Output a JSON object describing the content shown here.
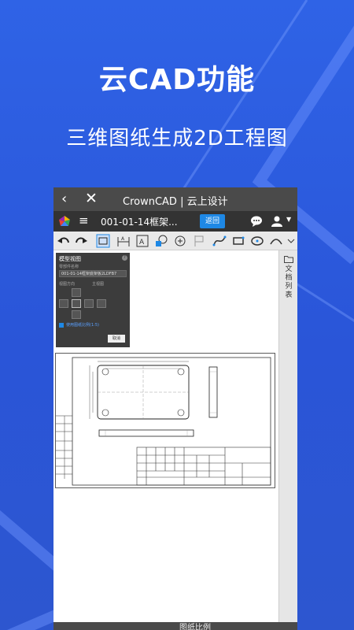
{
  "colors": {
    "background": "#2f63e6",
    "accent": "#1e88e5",
    "titlebar": "#4a4a4a",
    "appbar": "#333333",
    "toolbar": "#e9e9e9"
  },
  "headline": "云CAD功能",
  "subline": "三维图纸生成2D工程图",
  "titlebar": {
    "back_icon": "chevron-left-icon",
    "close_icon": "close-icon",
    "title": "CrownCAD | 云上设计"
  },
  "appbar": {
    "document_name": "001-01-14框架...",
    "return_label": "返回",
    "icons": [
      "logo-icon",
      "menu-icon",
      "chat-icon",
      "user-icon",
      "chevron-down-icon"
    ]
  },
  "toolbar": {
    "icons": [
      "undo-icon",
      "redo-icon",
      "view-icon",
      "dimension-icon",
      "annotation-icon",
      "balloon-icon",
      "center-mark-icon",
      "flag-icon",
      "spline-icon",
      "rectangle-icon",
      "circle-icon",
      "arc-icon",
      "more-icon"
    ]
  },
  "right_panel": {
    "folder_icon": "folder-icon",
    "label": "文档列表"
  },
  "view_panel": {
    "title": "模型视图",
    "field_label": "零部件名称",
    "field_value": "001-01-14框架底架板2LDFB7",
    "orientation_label": "视图方向",
    "preset_label": "主视图",
    "checkbox_label": "使用图纸比例(1:5)",
    "cancel_label": "取消"
  },
  "bottom": {
    "label": "图纸比例"
  }
}
